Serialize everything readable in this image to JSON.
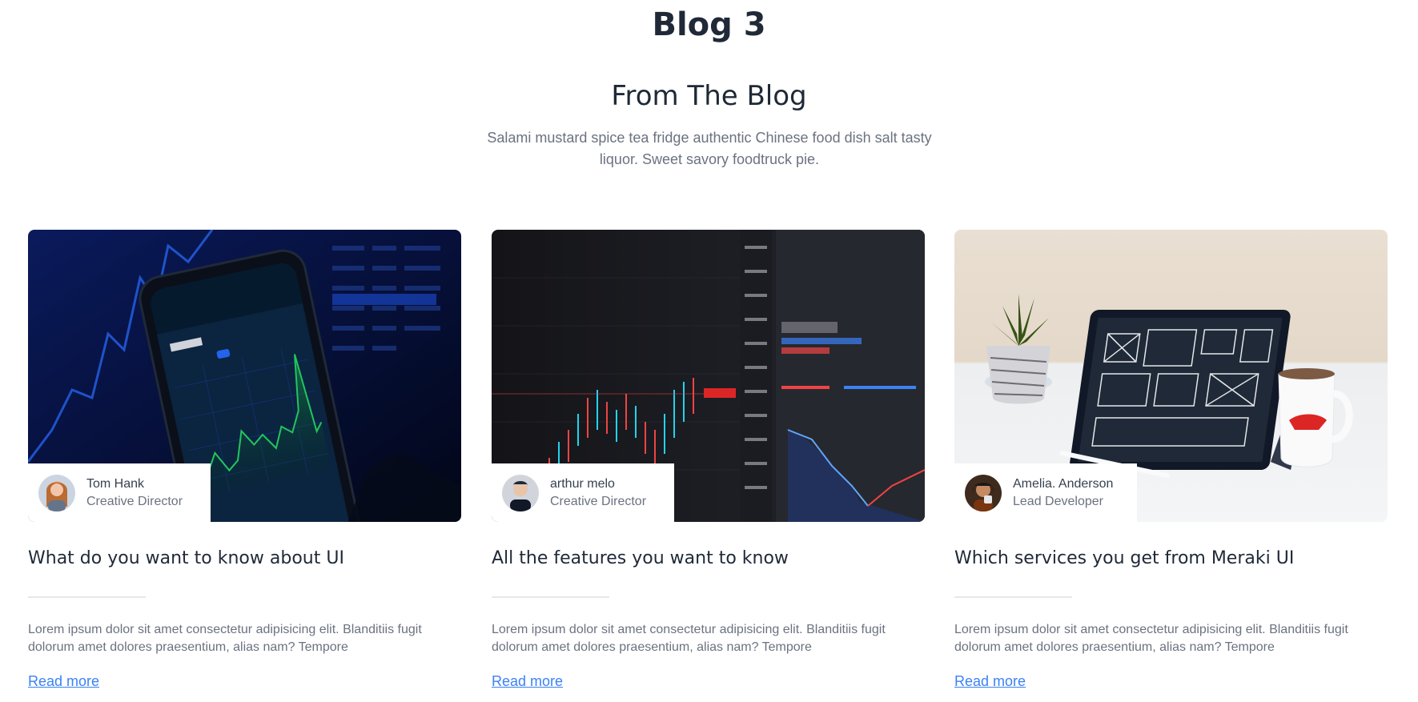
{
  "page": {
    "title": "Blog 3"
  },
  "section": {
    "heading": "From The Blog",
    "subtitle": "Salami mustard spice tea fridge authentic Chinese food dish salt tasty liquor. Sweet savory foodtruck pie."
  },
  "posts": [
    {
      "author_name": "Tom Hank",
      "author_role": "Creative Director",
      "title": "What do you want to know about UI",
      "excerpt": "Lorem ipsum dolor sit amet consectetur adipisicing elit. Blanditiis fugit dolorum amet dolores praesentium, alias nam? Tempore",
      "link_label": "Read more"
    },
    {
      "author_name": "arthur melo",
      "author_role": "Creative Director",
      "title": "All the features you want to know",
      "excerpt": "Lorem ipsum dolor sit amet consectetur adipisicing elit. Blanditiis fugit dolorum amet dolores praesentium, alias nam? Tempore",
      "link_label": "Read more"
    },
    {
      "author_name": "Amelia. Anderson",
      "author_role": "Lead Developer",
      "title": "Which services you get from Meraki UI",
      "excerpt": "Lorem ipsum dolor sit amet consectetur adipisicing elit. Blanditiis fugit dolorum amet dolores praesentium, alias nam? Tempore",
      "link_label": "Read more"
    }
  ],
  "colors": {
    "heading": "#1f2937",
    "muted": "#6b7280",
    "link": "#3b82f6"
  }
}
